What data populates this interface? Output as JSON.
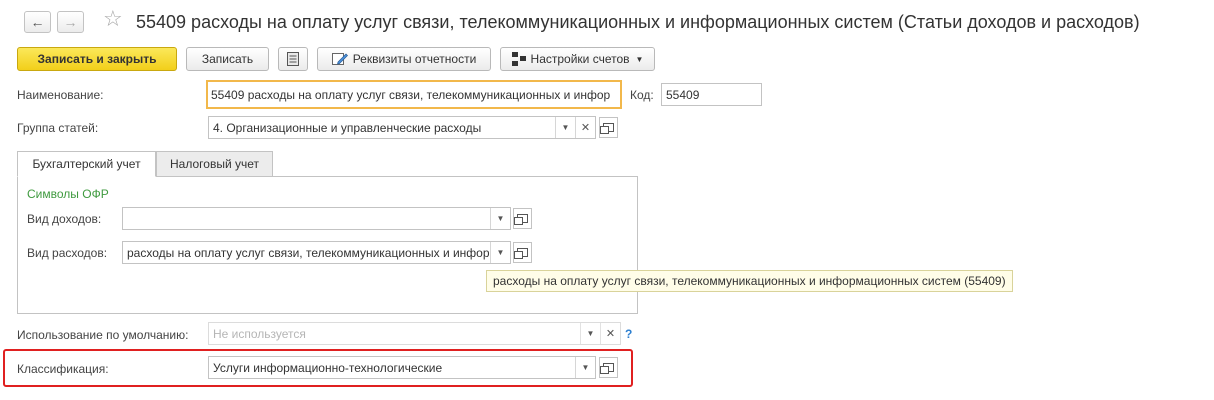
{
  "window": {
    "title": "55409 расходы на оплату услуг связи, телекоммуникационных и информационных систем (Статьи доходов и расходов)"
  },
  "toolbar": {
    "save_close_label": "Записать и закрыть",
    "save_label": "Записать",
    "report_details_label": "Реквизиты отчетности",
    "account_settings_label": "Настройки счетов"
  },
  "form": {
    "name_label": "Наименование:",
    "name_value": "55409 расходы на оплату услуг связи, телекоммуникационных и инфор",
    "code_label": "Код:",
    "code_value": "55409",
    "group_label": "Группа статей:",
    "group_value": "4. Организационные и управленческие расходы",
    "usage_label": "Использование по умолчанию:",
    "usage_placeholder": "Не используется",
    "usage_help": "?",
    "classification_label": "Классификация:",
    "classification_value": "Услуги информационно-технологические"
  },
  "tabs": [
    {
      "label": "Бухгалтерский учет",
      "active": true
    },
    {
      "label": "Налоговый учет",
      "active": false
    }
  ],
  "accounting": {
    "section_title": "Символы ОФР",
    "income_type_label": "Вид доходов:",
    "income_type_value": "",
    "expense_type_label": "Вид расходов:",
    "expense_type_value": "расходы на оплату услуг связи, телекоммуникационных и инфор"
  },
  "tooltip": {
    "text": "расходы на оплату услуг связи, телекоммуникационных и информационных систем (55409)"
  },
  "colors": {
    "primary_button": "#f5d62a",
    "highlight_border": "#e02020",
    "section_title": "#3f9a3f",
    "focus_border": "#f2b84b"
  }
}
